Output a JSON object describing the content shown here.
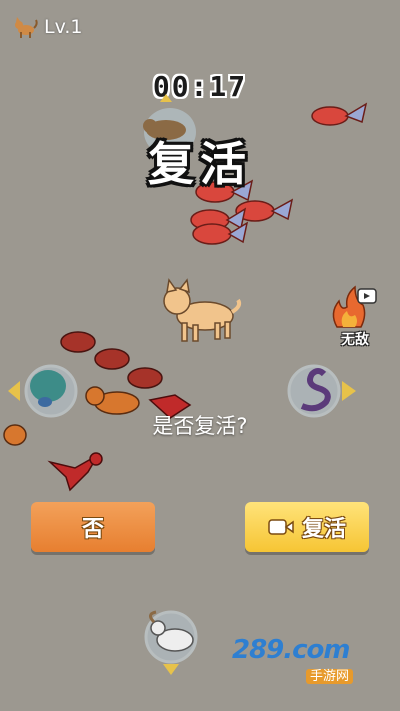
{
  "hud": {
    "level": "Lv.1",
    "timer": "00:17"
  },
  "dialog": {
    "title": "复活",
    "question": "是否复活?",
    "no_button": "否",
    "revive_button": "复活"
  },
  "powerup": {
    "label": "无敌"
  },
  "watermark": {
    "domain": "289.com",
    "sub": "手游网"
  },
  "colors": {
    "background": "#9c9890",
    "no_button": "#ee8e42",
    "revive_button": "#f8d149"
  }
}
